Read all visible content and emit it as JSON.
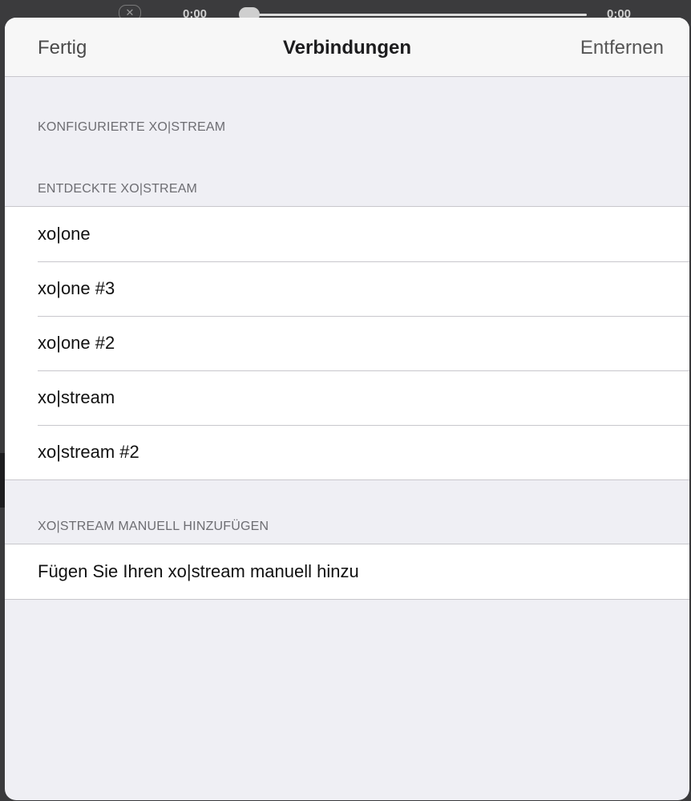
{
  "media": {
    "time_left": "0:00",
    "time_right": "0:00",
    "close_icon": "close-icon"
  },
  "navbar": {
    "left_label": "Fertig",
    "title": "Verbindungen",
    "right_label": "Entfernen"
  },
  "sections": {
    "configured": {
      "header": "KONFIGURIERTE XO|STREAM"
    },
    "discovered": {
      "header": "ENTDECKTE XO|STREAM",
      "items": [
        {
          "label": "xo|one"
        },
        {
          "label": "xo|one #3"
        },
        {
          "label": "xo|one #2"
        },
        {
          "label": "xo|stream"
        },
        {
          "label": "xo|stream #2"
        }
      ]
    },
    "manual": {
      "header": "XO|STREAM MANUELL HINZUFÜGEN",
      "items": [
        {
          "label": "Fügen Sie Ihren xo|stream manuell hinzu"
        }
      ]
    }
  },
  "colors": {
    "sheet_background": "#efeff4",
    "row_background": "#ffffff",
    "separator": "#c8c7cc",
    "section_header_text": "#6d6d72"
  }
}
